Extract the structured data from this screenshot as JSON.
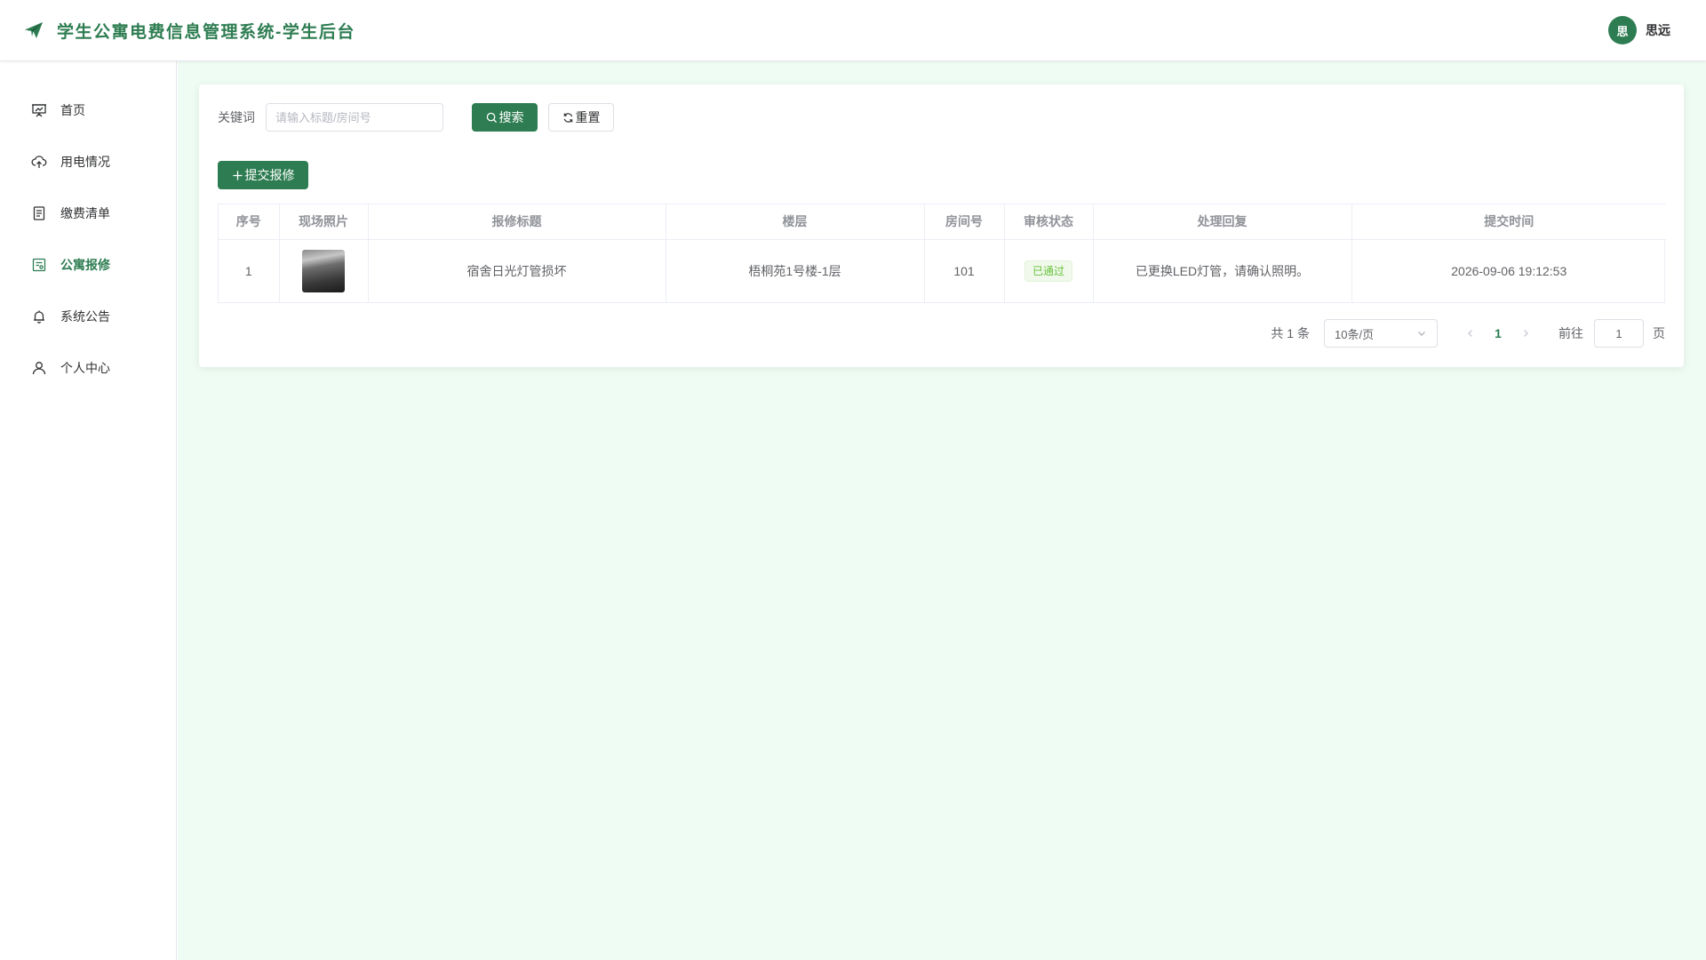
{
  "header": {
    "title": "学生公寓电费信息管理系统-学生后台",
    "user_avatar": "思",
    "user_name": "思远",
    "accent_color": "#2e7d52"
  },
  "sidebar": {
    "items": [
      {
        "label": "首页",
        "icon": "presentation-chart-icon",
        "active": false
      },
      {
        "label": "用电情况",
        "icon": "cloud-upload-icon",
        "active": false
      },
      {
        "label": "缴费清单",
        "icon": "document-icon",
        "active": false
      },
      {
        "label": "公寓报修",
        "icon": "tickets-icon",
        "active": true
      },
      {
        "label": "系统公告",
        "icon": "bell-icon",
        "active": false
      },
      {
        "label": "个人中心",
        "icon": "user-icon",
        "active": false
      }
    ]
  },
  "search": {
    "label": "关键词",
    "placeholder": "请输入标题/房间号",
    "value": "",
    "search_button": "搜索",
    "reset_button": "重置"
  },
  "toolbar": {
    "add_button": "提交报修"
  },
  "table": {
    "columns": [
      "序号",
      "现场照片",
      "报修标题",
      "楼层",
      "房间号",
      "审核状态",
      "处理回复",
      "提交时间"
    ],
    "rows": [
      {
        "index": "1",
        "photo": "photo-thumbnail",
        "title": "宿舍日光灯管损坏",
        "floor": "梧桐苑1号楼-1层",
        "room": "101",
        "status": "已通过",
        "reply": "已更换LED灯管，请确认照明。",
        "time": "2026-09-06 19:12:53"
      }
    ]
  },
  "pagination": {
    "total_text": "共 1 条",
    "page_size": "10条/页",
    "current_page": "1",
    "goto_label": "前往",
    "goto_value": "1",
    "goto_unit": "页"
  }
}
